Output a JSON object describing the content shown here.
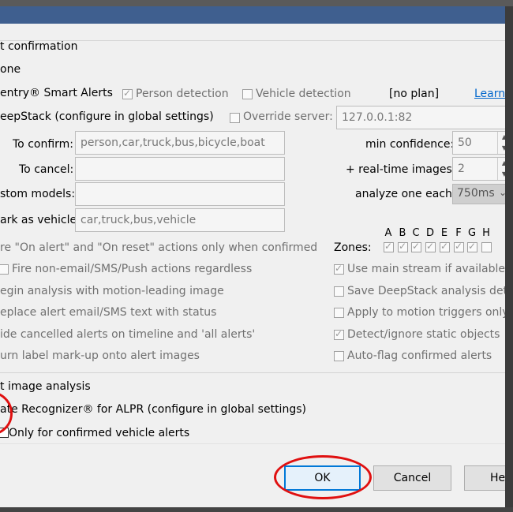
{
  "header": {
    "alert_confirmation": "t confirmation",
    "none_option": "one",
    "sentry_label": "entry® Smart Alerts",
    "person_detection": "Person detection",
    "vehicle_detection": "Vehicle detection",
    "no_plan": "[no plan]",
    "learn_more": "Learn M",
    "deepstack_label": "eepStack (configure in global settings)",
    "override_server": "Override server:",
    "server_value": "127.0.0.1:82"
  },
  "fields": {
    "to_confirm_label": "To confirm:",
    "to_confirm_value": "person,car,truck,bus,bicycle,boat",
    "to_cancel_label": "To cancel:",
    "to_cancel_value": "",
    "custom_models_label": "stom models:",
    "custom_models_value": "",
    "mark_vehicle_label": "ark as vehicle:",
    "mark_vehicle_value": "car,truck,bus,vehicle",
    "min_confidence_label": "min confidence:",
    "min_confidence_value": "50",
    "realtime_label": "+ real-time images:",
    "realtime_value": "2",
    "analyze_label": "analyze one each:",
    "analyze_value": "750ms"
  },
  "zones": {
    "label": "Zones:",
    "letters": [
      "A",
      "B",
      "C",
      "D",
      "E",
      "F",
      "G",
      "H"
    ]
  },
  "left_options": {
    "fire_on_alert": "re \"On alert\" and \"On reset\" actions only when confirmed",
    "fire_non_email": "Fire non-email/SMS/Push actions regardless",
    "begin_analysis": "egin analysis with motion-leading image",
    "replace_alert": "eplace alert email/SMS text with status",
    "hide_cancelled": "ide cancelled alerts on timeline and  'all alerts'",
    "burn_label": "urn label mark-up onto alert images"
  },
  "right_options": {
    "main_stream": "Use main stream if available",
    "save_deepstack": "Save DeepStack analysis details",
    "motion_triggers": "Apply to motion triggers only",
    "static_objects": "Detect/ignore static objects",
    "auto_flag": "Auto-flag confirmed alerts"
  },
  "alpr": {
    "section": "t image analysis",
    "plate_recognizer": "ate Recognizer® for ALPR (configure in global settings)",
    "only_confirmed": "Only for confirmed vehicle alerts"
  },
  "buttons": {
    "ok": "OK",
    "cancel": "Cancel",
    "help": "Help"
  },
  "colors": {
    "title_bar": "#3f5f8f",
    "annotation_red": "#e01010",
    "link_blue": "#0066cc"
  }
}
